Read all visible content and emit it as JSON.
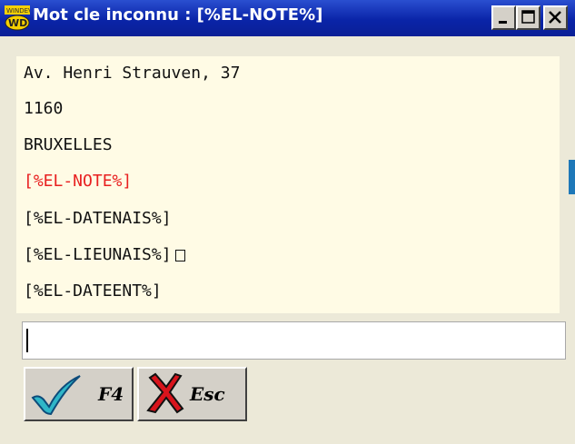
{
  "window": {
    "title": "Mot cle inconnu : [%EL-NOTE%]",
    "app_icon": "wd-app-icon",
    "controls": [
      "minimize-icon",
      "maximize-icon",
      "close-icon"
    ]
  },
  "textarea": {
    "lines": [
      {
        "text": "Av. Henri Strauven, 37",
        "color": "#111111"
      },
      {
        "text": "1160",
        "color": "#111111"
      },
      {
        "text": "BRUXELLES",
        "color": "#111111"
      },
      {
        "text": "[%EL-NOTE%]",
        "color": "#e82020"
      },
      {
        "text": "[%EL-DATENAIS%]",
        "color": "#111111"
      },
      {
        "text": "[%EL-LIEUNAIS%]",
        "color": "#111111"
      },
      {
        "text": "[%EL-DATEENT%]",
        "color": "#111111"
      }
    ]
  },
  "input": {
    "value": ""
  },
  "buttons": {
    "ok": {
      "label": "F4",
      "icon": "checkmark-icon"
    },
    "cancel": {
      "label": "Esc",
      "icon": "red-x-icon"
    }
  },
  "colors": {
    "titlebar": "#0a24a8",
    "textarea_bg": "#fffbe5",
    "highlight_text": "#e82020",
    "window_bg": "#ece9d8"
  }
}
